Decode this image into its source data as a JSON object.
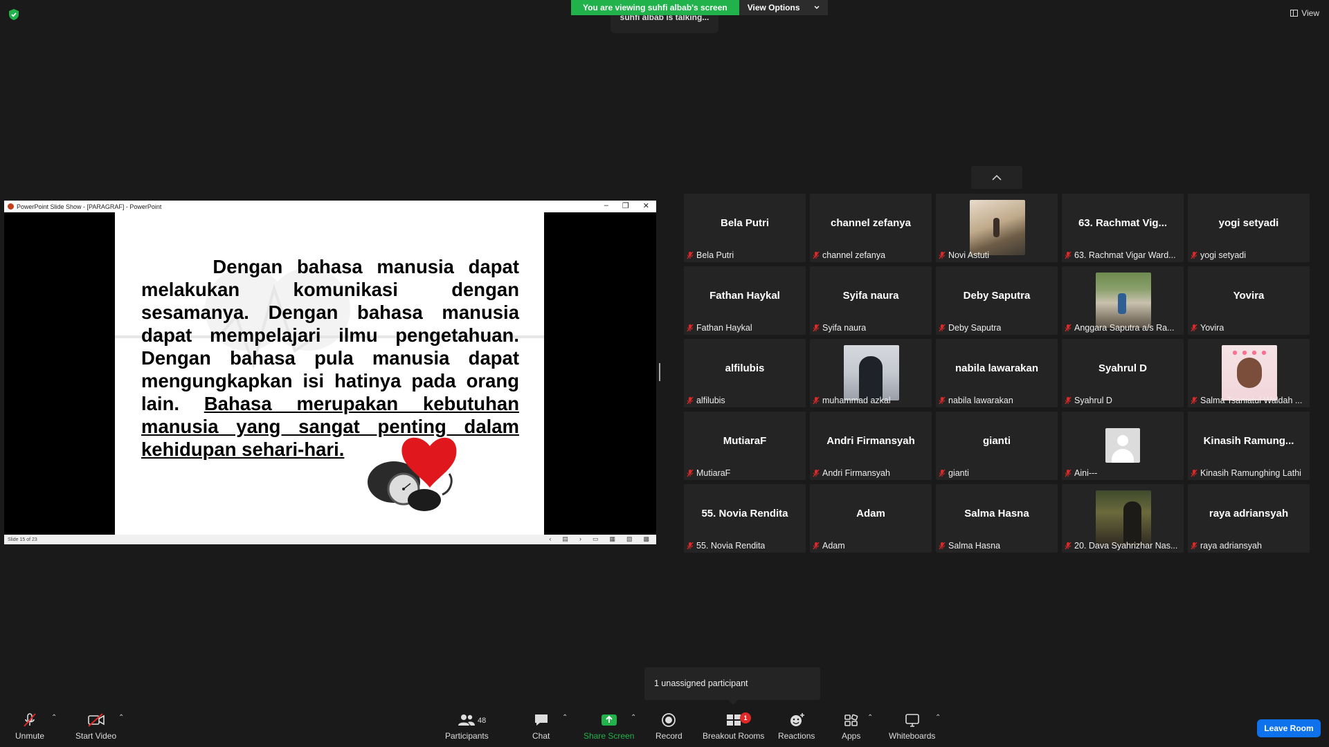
{
  "banner": {
    "viewing": "You are viewing suhfi albab's screen",
    "view_options": "View Options",
    "talking": "suhfi albab is talking..."
  },
  "view_label": "View",
  "share": {
    "window_title": "PowerPoint Slide Show - [PARAGRAF] - PowerPoint",
    "slide_status": "Slide 15 of 23",
    "paragraph_plain": "Dengan bahasa manusia dapat melakukan komunikasi dengan sesamanya. Dengan bahasa manusia dapat mempelajari ilmu pengetahuan. Dengan bahasa pula manusia dapat mengungkapkan isi hatinya pada orang lain.",
    "paragraph_underlined": "Bahasa merupakan kebutuhan manusia yang sangat penting dalam kehidupan sehari-hari."
  },
  "participants": [
    {
      "big": "Bela Putri",
      "label": "Bela Putri"
    },
    {
      "big": "channel zefanya",
      "label": "channel zefanya"
    },
    {
      "big": "",
      "label": "Novi Astuti",
      "photo": "ph-novi"
    },
    {
      "big": "63. Rachmat Vig...",
      "label": "63. Rachmat Vigar Ward..."
    },
    {
      "big": "yogi setyadi",
      "label": "yogi setyadi"
    },
    {
      "big": "Fathan Haykal",
      "label": "Fathan Haykal"
    },
    {
      "big": "Syifa naura",
      "label": "Syifa naura"
    },
    {
      "big": "Deby Saputra",
      "label": "Deby Saputra"
    },
    {
      "big": "",
      "label": "Anggara Saputra a/s Ra...",
      "photo": "ph-anggara"
    },
    {
      "big": "Yovira",
      "label": "Yovira"
    },
    {
      "big": "alfilubis",
      "label": "alfilubis"
    },
    {
      "big": "",
      "label": "muhammad azkal",
      "photo": "ph-akzal"
    },
    {
      "big": "nabila lawarakan",
      "label": "nabila lawarakan"
    },
    {
      "big": "Syahrul D",
      "label": "Syahrul D"
    },
    {
      "big": "",
      "label": "Salma Tsaniatul Waldah ...",
      "photo": "ph-salma"
    },
    {
      "big": "MutiaraF",
      "label": "MutiaraF"
    },
    {
      "big": "Andri Firmansyah",
      "label": "Andri Firmansyah"
    },
    {
      "big": "gianti",
      "label": "gianti"
    },
    {
      "big": "",
      "label": "Aini---",
      "photo": "ph-aini"
    },
    {
      "big": "Kinasih Ramung...",
      "label": "Kinasih Ramunghing Lathi"
    },
    {
      "big": "55. Novia Rendita",
      "label": "55. Novia Rendita"
    },
    {
      "big": "Adam",
      "label": "Adam"
    },
    {
      "big": "Salma Hasna",
      "label": "Salma Hasna"
    },
    {
      "big": "",
      "label": "20. Dava Syahrizhar Nas...",
      "photo": "ph-dava"
    },
    {
      "big": "raya adriansyah",
      "label": "raya adriansyah"
    }
  ],
  "toast": "1 unassigned participant",
  "toolbar": {
    "unmute": "Unmute",
    "start_video": "Start Video",
    "participants": "Participants",
    "participants_count": "48",
    "chat": "Chat",
    "share_screen": "Share Screen",
    "record": "Record",
    "breakout_rooms": "Breakout Rooms",
    "breakout_badge": "1",
    "reactions": "Reactions",
    "apps": "Apps",
    "whiteboards": "Whiteboards",
    "leave": "Leave Room"
  },
  "colors": {
    "accent_green": "#21b24b",
    "leave_blue": "#0e72ed",
    "mute_red": "#e02828"
  }
}
